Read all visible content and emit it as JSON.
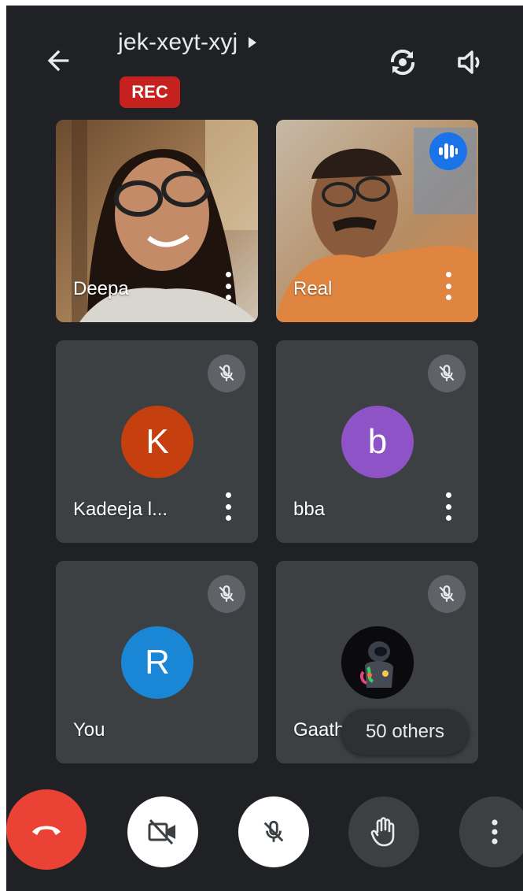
{
  "header": {
    "meeting_code": "jek-xeyt-xyj",
    "rec_label": "REC"
  },
  "tiles": [
    {
      "name": "Deepa",
      "type": "video"
    },
    {
      "name": "Real",
      "type": "video",
      "speaking": true
    },
    {
      "name": "Kadeeja l...",
      "initial": "K",
      "avatar_color": "#c5400e",
      "muted": true
    },
    {
      "name": "bba",
      "initial": "b",
      "avatar_color": "#8e53c6",
      "muted": true
    },
    {
      "name": "You",
      "initial": "R",
      "avatar_color": "#1a86d6",
      "muted": true
    },
    {
      "name": "Gaath",
      "type": "photo-avatar",
      "muted": true
    }
  ],
  "others_label": "50 others",
  "controls": [
    {
      "icon": "end-call-icon"
    },
    {
      "icon": "camera-off-icon"
    },
    {
      "icon": "mic-off-icon"
    },
    {
      "icon": "raise-hand-icon"
    },
    {
      "icon": "more-options-icon"
    }
  ],
  "colors": {
    "background": "#202124",
    "tile": "#3c4043",
    "rec": "#c5221f",
    "end_call": "#ea4335",
    "speaking": "#1a73e8"
  }
}
